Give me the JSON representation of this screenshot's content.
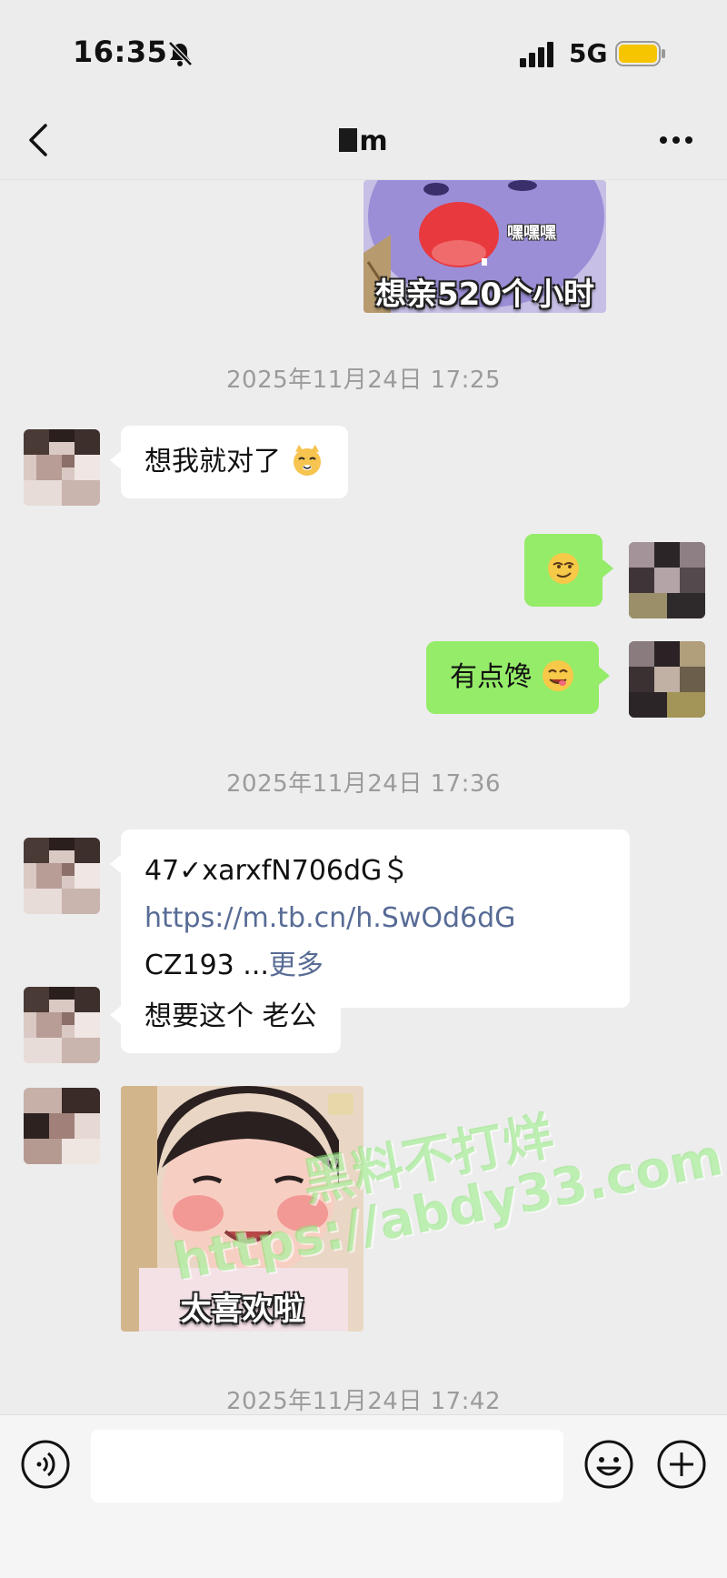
{
  "status_bar": {
    "time": "16:35",
    "network": "5G"
  },
  "nav": {
    "title": "m"
  },
  "stickers": {
    "first": {
      "small_text": "嘿嘿嘿",
      "caption": "想亲520个小时"
    },
    "second": {
      "caption": "太喜欢啦"
    }
  },
  "timestamps": {
    "t1": "2025年11月24日 17:25",
    "t2": "2025年11月24日 17:36",
    "t3": "2025年11月24日 17:42"
  },
  "messages": {
    "m1": "想我就对了",
    "m3": "有点馋",
    "link_prefix": "47✓xarxfN706dG＄ ",
    "link_url": "https://m.tb.cn/h.SwOd6dG",
    "link_suffix": " CZ193 ...",
    "link_more": "更多",
    "m5": "想要这个 老公"
  },
  "watermark": {
    "line1": "黑料不打烊",
    "line2": "https://abdy33.com"
  },
  "input": {
    "placeholder": ""
  },
  "icons": [
    "bell-off-icon",
    "signal-icon",
    "battery-icon",
    "back-icon",
    "more-icon",
    "voice-icon",
    "emoji-icon",
    "plus-icon"
  ],
  "colors": {
    "sent_bubble": "#95ec69",
    "received_bubble": "#ffffff",
    "background": "#ededed",
    "link": "#576b95",
    "battery": "#f7c500"
  }
}
